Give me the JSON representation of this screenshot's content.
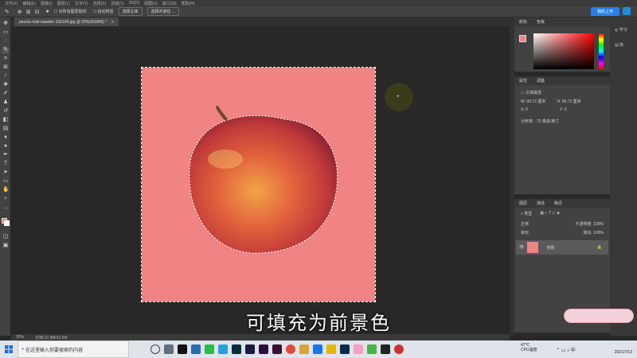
{
  "menu": [
    "文件(F)",
    "编辑(E)",
    "图像(I)",
    "图层(L)",
    "文字(Y)",
    "选择(S)",
    "滤镜(T)",
    "3D(D)",
    "视图(V)",
    "窗口(W)",
    "帮助(H)"
  ],
  "options": {
    "feather_checkbox_label": "对所有图层取样",
    "auto_enhance_label": "自动增强",
    "select_subject_label": "选择主体",
    "select_mask_label": "选择并遮住 ...",
    "cloud_label": "我的上传"
  },
  "document": {
    "tab_title": "pexels-mali-maeder-102104.jpg @ 25%(RGB/8) *",
    "fill_color": "#f08383"
  },
  "panels": {
    "color": {
      "tab1": "颜色",
      "tab2": "色板"
    },
    "properties": {
      "tab1": "属性",
      "tab2": "调整",
      "section": "文档属性",
      "w_label": "W:",
      "w_value": "99.72 厘米",
      "h_label": "H:",
      "h_value": "99.72 厘米",
      "x_label": "X:",
      "x_value": "0",
      "y_label": "Y:",
      "y_value": "0",
      "resolution": "分辨率：72 像素/英寸"
    },
    "layers": {
      "tab1": "图层",
      "tab2": "通道",
      "tab3": "路径",
      "mode": "正常",
      "opacity_label": "不透明度:",
      "opacity_value": "100%",
      "lock_label": "锁定:",
      "fill_label": "填充:",
      "fill_value": "100%",
      "layer_name": "背景"
    },
    "learn_label": "学习",
    "libraries_label": "库"
  },
  "status": {
    "zoom": "25%",
    "doc_size": "文档:22.9M/22.9M"
  },
  "subtitle": "可填充为前景色",
  "taskbar": {
    "search_placeholder": "在这里输入你要搜索的内容",
    "weather": "47°C",
    "weather_sub": "CPU温度",
    "time": "",
    "date": "2021/7/13"
  },
  "colors": {
    "foreground": "#f08383",
    "background": "#ffffff",
    "accent": "#2680eb"
  }
}
